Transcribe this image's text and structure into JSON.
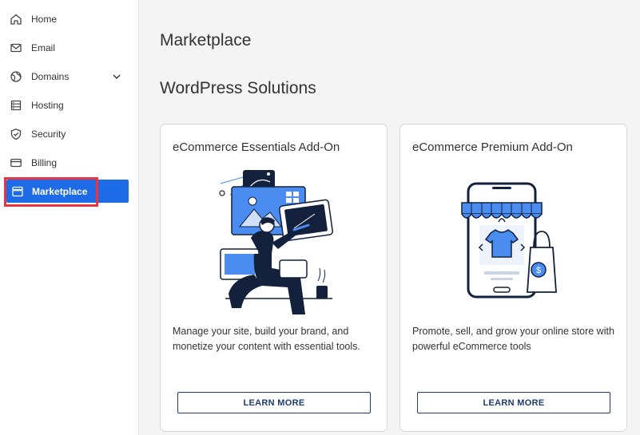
{
  "sidebar": {
    "items": [
      {
        "label": "Home",
        "icon": "home-icon"
      },
      {
        "label": "Email",
        "icon": "mail-icon"
      },
      {
        "label": "Domains",
        "icon": "globe-icon",
        "expandable": true
      },
      {
        "label": "Hosting",
        "icon": "server-icon"
      },
      {
        "label": "Security",
        "icon": "shield-icon"
      },
      {
        "label": "Billing",
        "icon": "credit-card-icon"
      },
      {
        "label": "Marketplace",
        "icon": "storefront-icon",
        "active": true
      }
    ]
  },
  "main": {
    "page_title": "Marketplace",
    "section_title": "WordPress Solutions",
    "cards": [
      {
        "title": "eCommerce Essentials Add-On",
        "description": "Manage your site, build your brand, and monetize your content with essential tools.",
        "button_label": "LEARN MORE",
        "illustration": "designer-at-screens-illustration"
      },
      {
        "title": "eCommerce Premium Add-On",
        "description": "Promote, sell, and grow your online store with powerful eCommerce tools",
        "button_label": "LEARN MORE",
        "illustration": "phone-storefront-illustration"
      }
    ]
  },
  "colors": {
    "accent": "#1e6be8",
    "highlight": "#ea3340",
    "button_border": "#1d3b6e",
    "illustration_blue": "#4a8cf0",
    "illustration_dark": "#13213d"
  }
}
